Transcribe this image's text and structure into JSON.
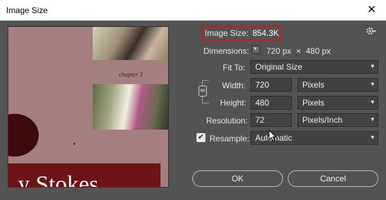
{
  "window": {
    "title": "Image Size",
    "close_glyph": "✕"
  },
  "preview": {
    "chapter_text": "chapter 3",
    "banner_text": "y Stokes"
  },
  "image_size": {
    "label": "Image Size:",
    "value": "854.3K"
  },
  "dimensions": {
    "label": "Dimensions:",
    "width": "720 px",
    "times": "×",
    "height": "480 px"
  },
  "fit_to": {
    "label": "Fit To:",
    "value": "Original Size"
  },
  "width": {
    "label": "Width:",
    "value": "720",
    "unit": "Pixels"
  },
  "height": {
    "label": "Height:",
    "value": "480",
    "unit": "Pixels"
  },
  "resolution": {
    "label": "Resolution:",
    "value": "72",
    "unit": "Pixels/Inch"
  },
  "resample": {
    "label": "Resample:",
    "value": "Automatic",
    "checked": true
  },
  "buttons": {
    "ok": "OK",
    "cancel": "Cancel"
  },
  "icons": {
    "gear": "gear-icon",
    "link": "link-chain-icon",
    "check": "checkmark-icon"
  }
}
